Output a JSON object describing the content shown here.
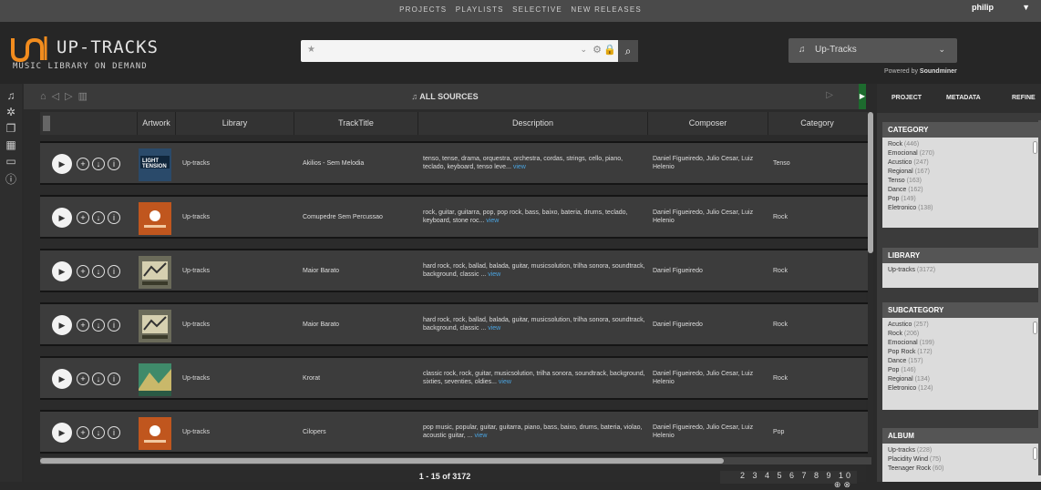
{
  "topnav": {
    "links": [
      "PROJECTS",
      "PLAYLISTS",
      "SELECTIVE",
      "NEW RELEASES"
    ],
    "user": "philip"
  },
  "header": {
    "logo_title": "UP-TRACKS",
    "logo_subtitle": "MUSIC LIBRARY ON DEMAND",
    "search_value": "",
    "source_label": "Up-Tracks",
    "powered_prefix": "Powered by",
    "powered_brand": "Soundminer"
  },
  "toolbar": {
    "title": "ALL SOURCES"
  },
  "table": {
    "columns": [
      "Artwork",
      "Library",
      "TrackTitle",
      "Description",
      "Composer",
      "Category"
    ],
    "rows": [
      {
        "library": "Up-tracks",
        "title": "Akilios - Sem Melodia",
        "description": "tenso, tense, drama, orquestra, orchestra, cordas, strings, cello, piano, teclado, keyboard, tenso leve...",
        "composer": "Daniel Figueiredo, Julio Cesar, Luiz Helenio",
        "category": "Tenso",
        "art": "light-tension"
      },
      {
        "library": "Up-tracks",
        "title": "Comupedre Sem Percussao",
        "description": "rock, guitar, guitarra, pop, pop rock, bass, baixo, bateria, drums, teclado, keyboard, stone roc...",
        "composer": "Daniel Figueiredo, Julio Cesar, Luiz Helenio",
        "category": "Rock",
        "art": "orange"
      },
      {
        "library": "Up-tracks",
        "title": "Maior Barato",
        "description": "hard rock, rock, ballad, balada, guitar, musicsolution, trilha sonora, soundtrack, background, classic ...",
        "composer": "Daniel Figueiredo",
        "category": "Rock",
        "art": "rock"
      },
      {
        "library": "Up-tracks",
        "title": "Maior Barato",
        "description": "hard rock, rock, ballad, balada, guitar, musicsolution, trilha sonora, soundtrack, background, classic ...",
        "composer": "Daniel Figueiredo",
        "category": "Rock",
        "art": "rock"
      },
      {
        "library": "Up-tracks",
        "title": "Krorat",
        "description": "classic rock, rock, guitar, musicsolution, trilha sonora, soundtrack, background, sixties, seventies, oldies...",
        "composer": "Daniel Figueiredo, Julio Cesar, Luiz Helenio",
        "category": "Rock",
        "art": "green"
      },
      {
        "library": "Up-tracks",
        "title": "Cilopers",
        "description": "pop music, popular, guitar, guitarra, piano, bass, baixo, drums, bateria, violao, acoustic guitar, ...",
        "composer": "Daniel Figueiredo, Julio Cesar, Luiz Helenio",
        "category": "Pop",
        "art": "orange"
      }
    ],
    "view_label": "view"
  },
  "footer": {
    "count": "1 - 15 of 3172",
    "pages": "2 3 4 5 6 7 8 9 10"
  },
  "rightpanel": {
    "tabs": [
      "PROJECT",
      "METADATA",
      "REFINE"
    ],
    "category": {
      "title": "CATEGORY",
      "items": [
        {
          "name": "Rock",
          "count": "(446)"
        },
        {
          "name": "Emocional",
          "count": "(270)"
        },
        {
          "name": "Acustico",
          "count": "(247)"
        },
        {
          "name": "Regional",
          "count": "(167)"
        },
        {
          "name": "Tenso",
          "count": "(163)"
        },
        {
          "name": "Dance",
          "count": "(162)"
        },
        {
          "name": "Pop",
          "count": "(149)"
        },
        {
          "name": "Eletronico",
          "count": "(138)"
        }
      ]
    },
    "library": {
      "title": "LIBRARY",
      "items": [
        {
          "name": "Up-tracks",
          "count": "(3172)"
        }
      ]
    },
    "subcategory": {
      "title": "SUBCATEGORY",
      "items": [
        {
          "name": "Acustico",
          "count": "(257)"
        },
        {
          "name": "Rock",
          "count": "(206)"
        },
        {
          "name": "Emocional",
          "count": "(199)"
        },
        {
          "name": "Pop Rock",
          "count": "(172)"
        },
        {
          "name": "Dance",
          "count": "(157)"
        },
        {
          "name": "Pop",
          "count": "(146)"
        },
        {
          "name": "Regional",
          "count": "(134)"
        },
        {
          "name": "Eletronico",
          "count": "(124)"
        }
      ]
    },
    "album": {
      "title": "ALBUM",
      "items": [
        {
          "name": "Up-tracks",
          "count": "(228)"
        },
        {
          "name": "Placidity Wind",
          "count": "(75)"
        },
        {
          "name": "Teenager Rock",
          "count": "(60)"
        }
      ]
    }
  },
  "colors": {
    "accent_orange": "#f28c1e",
    "link_blue": "#4aa3df",
    "green_arrow": "#1d6b2e"
  }
}
